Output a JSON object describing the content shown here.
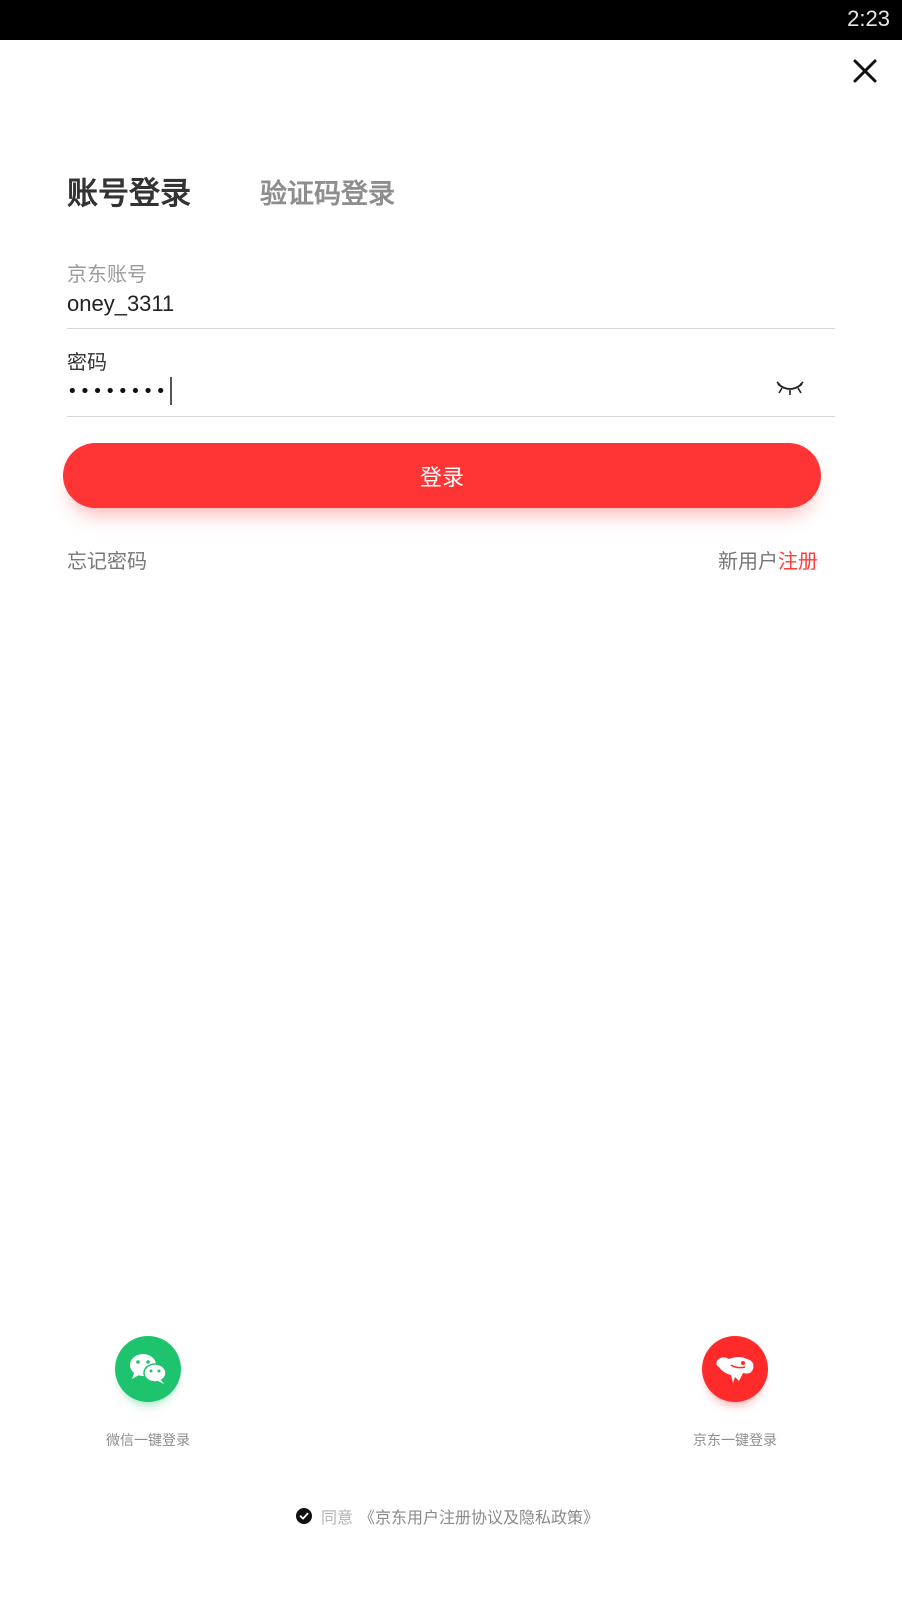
{
  "status_bar": {
    "time": "2:23"
  },
  "tabs": {
    "account_login": "账号登录",
    "sms_login": "验证码登录"
  },
  "account_field": {
    "label": "京东账号",
    "value": "oney_3311"
  },
  "password_field": {
    "label": "密码",
    "masked_value": "••••••••"
  },
  "login_button": {
    "label": "登录"
  },
  "links": {
    "forgot_password": "忘记密码",
    "new_user": "新用户",
    "register": "注册"
  },
  "quick_login": {
    "wechat_label": "微信一键登录",
    "jd_label": "京东一键登录"
  },
  "agreement": {
    "agree": "同意",
    "link": "《京东用户注册协议及隐私政策》"
  },
  "colors": {
    "primary_red": "#ff3535",
    "wechat_green": "#1ec36d"
  },
  "icons": {
    "close": "close-icon",
    "eye": "eye-closed-icon",
    "wechat": "wechat-icon",
    "jd": "jd-dog-icon",
    "check": "check-circle-icon"
  }
}
